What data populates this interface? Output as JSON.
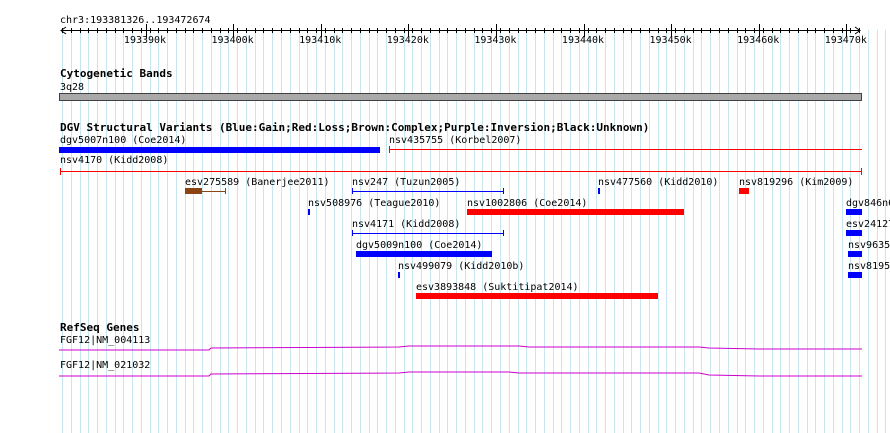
{
  "ruler": {
    "location": "chr3:193381326..193472674",
    "ticks": [
      "193390k",
      "193400k",
      "193410k",
      "193420k",
      "193430k",
      "193440k",
      "193450k",
      "193460k",
      "193470k"
    ]
  },
  "cytoband": {
    "title": "Cytogenetic Bands",
    "band": "3q28"
  },
  "dgv": {
    "title": "DGV Structural Variants (Blue:Gain;Red:Loss;Brown:Complex;Purple:Inversion;Black:Unknown)",
    "variants": [
      {
        "label": "dgv5007n100 (Coe2014)",
        "type": "gain"
      },
      {
        "label": "nsv435755 (Korbel2007)",
        "type": "loss"
      },
      {
        "label": "nsv4170 (Kidd2008)",
        "type": "loss"
      },
      {
        "label": "esv275589 (Banerjee2011)",
        "type": "complex"
      },
      {
        "label": "nsv247 (Tuzun2005)",
        "type": "gain"
      },
      {
        "label": "nsv477560 (Kidd2010)",
        "type": "gain"
      },
      {
        "label": "nsv819296 (Kim2009)",
        "type": "loss"
      },
      {
        "label": "dgv846n6",
        "type": "gain"
      },
      {
        "label": "nsv508976 (Teague2010)",
        "type": "gain"
      },
      {
        "label": "nsv1002806 (Coe2014)",
        "type": "loss"
      },
      {
        "label": "esv24127",
        "type": "gain"
      },
      {
        "label": "nsv4171 (Kidd2008)",
        "type": "gain"
      },
      {
        "label": "nsv9635",
        "type": "gain"
      },
      {
        "label": "dgv5009n100 (Coe2014)",
        "type": "gain"
      },
      {
        "label": "nsv8195",
        "type": "gain"
      },
      {
        "label": "nsv499079 (Kidd2010b)",
        "type": "gain"
      },
      {
        "label": "esv3893848 (Suktitipat2014)",
        "type": "loss"
      }
    ]
  },
  "refseq": {
    "title": "RefSeq Genes",
    "genes": [
      {
        "label": "FGF12|NM_004113"
      },
      {
        "label": "FGF12|NM_021032"
      }
    ]
  },
  "colors": {
    "gain": "#0000ff",
    "loss": "#ff0000",
    "complex": "#8b4513",
    "gene": "#cc00cc",
    "grid": "#c8e6f0"
  }
}
